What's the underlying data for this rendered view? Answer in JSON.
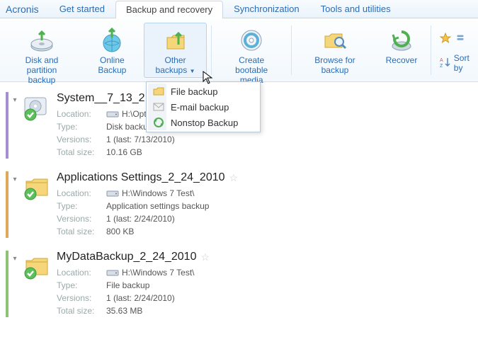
{
  "brand": "Acronis",
  "tabs": [
    "Get started",
    "Backup and recovery",
    "Synchronization",
    "Tools and utilities"
  ],
  "activeTabIndex": 1,
  "ribbon": {
    "diskPartition": "Disk and partition\nbackup",
    "onlineBackup": "Online Backup",
    "otherBackups": "Other backups",
    "createBootable": "Create bootable\nmedia",
    "browse": "Browse for backup",
    "recover": "Recover",
    "sortBy": "Sort by"
  },
  "dropdown": {
    "items": [
      "File backup",
      "E-mail backup",
      "Nonstop Backup"
    ]
  },
  "meta_labels": {
    "location": "Location:",
    "type": "Type:",
    "versions": "Versions:",
    "totalSize": "Total size:"
  },
  "entries": [
    {
      "title": "System__7_13_2",
      "location": "H:\\Optop",
      "type": "Disk backup",
      "versions": "1  (last: 7/13/2010)",
      "totalSize": "10.16 GB",
      "bar": "purple",
      "iconKind": "disk"
    },
    {
      "title": "Applications Settings_2_24_2010",
      "location": "H:\\Windows 7 Test\\",
      "type": "Application settings backup",
      "versions": "1  (last: 2/24/2010)",
      "totalSize": "800 KB",
      "bar": "orange",
      "iconKind": "folder"
    },
    {
      "title": "MyDataBackup_2_24_2010",
      "location": "H:\\Windows 7 Test\\",
      "type": "File backup",
      "versions": "1  (last: 2/24/2010)",
      "totalSize": "35.63 MB",
      "bar": "green",
      "iconKind": "folder"
    }
  ]
}
